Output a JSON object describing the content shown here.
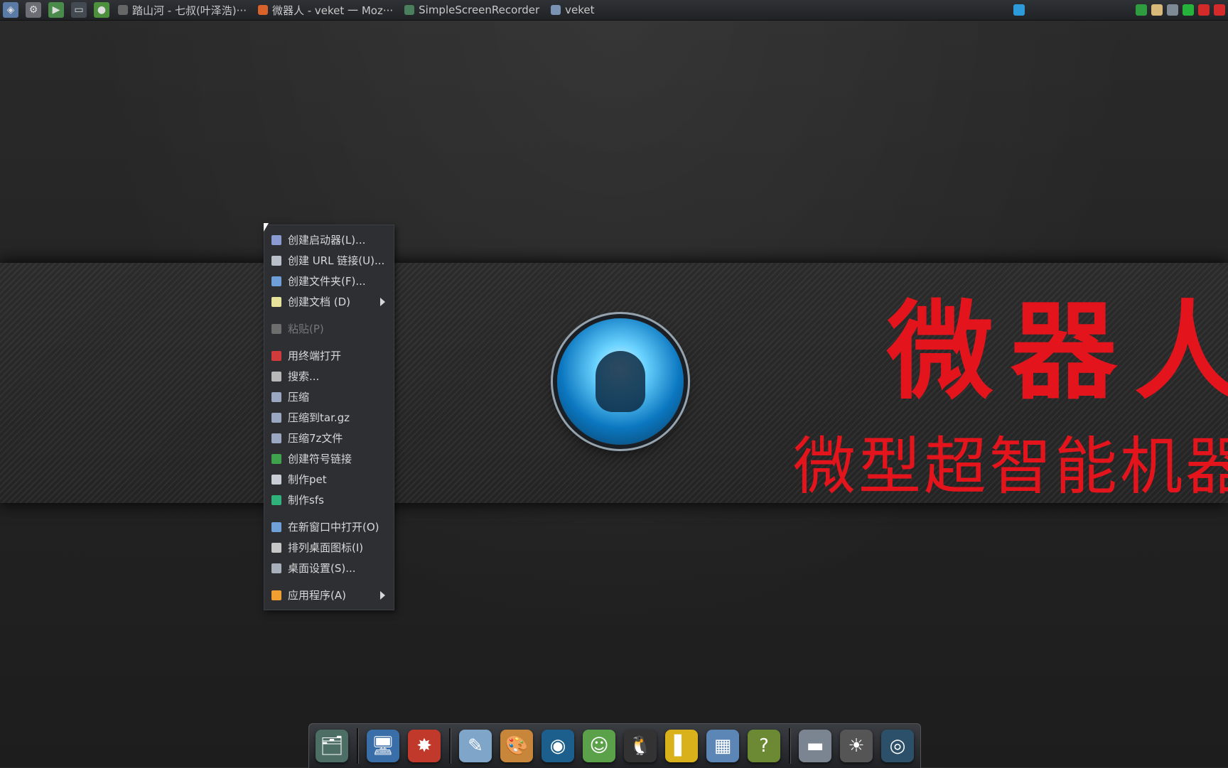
{
  "taskbar": {
    "launchers": [
      {
        "icon": "system-monitor-icon",
        "glyph": "◈",
        "color": "#5a7ba6"
      },
      {
        "icon": "settings-gear-icon",
        "glyph": "⚙",
        "color": "#6b6f75"
      },
      {
        "icon": "play-icon",
        "glyph": "▶",
        "color": "#4a8a4a"
      },
      {
        "icon": "terminal-icon",
        "glyph": "▭",
        "color": "#444a52"
      },
      {
        "icon": "globe-icon",
        "glyph": "●",
        "color": "#4c8f3c"
      }
    ],
    "tasks": [
      {
        "label": "踏山河 - 七叔(叶泽浩)···",
        "icon": "music-player-icon",
        "color": "#666"
      },
      {
        "label": "微器人 - veket 一 Moz···",
        "icon": "firefox-icon",
        "color": "#d9622b"
      },
      {
        "label": "SimpleScreenRecorder",
        "icon": "recorder-icon",
        "color": "#4a7f5d"
      },
      {
        "label": "veket",
        "icon": "folder-icon",
        "color": "#7a93b5"
      }
    ],
    "tray": [
      {
        "icon": "display-icon",
        "color": "#2d9bd9"
      },
      {
        "icon": "shield-icon",
        "color": "#2e9c3f"
      },
      {
        "icon": "clipboard-icon",
        "color": "#d8b97a"
      },
      {
        "icon": "network-icon",
        "color": "#7e8a95"
      },
      {
        "icon": "battery-icon",
        "color": "#25b33c"
      },
      {
        "icon": "record-icon",
        "color": "#d42a2a"
      },
      {
        "icon": "input-method-icon",
        "color": "#d42a2a"
      }
    ]
  },
  "wallpaper": {
    "title": "微器人",
    "subtitle": "微型超智能机器",
    "title_color": "#e3141c"
  },
  "menu": {
    "items": [
      {
        "label": "创建启动器(L)...",
        "icon": "launcher-create-icon",
        "color": "#8a9bd1",
        "submenu": false,
        "disabled": false
      },
      {
        "label": "创建 URL 链接(U)...",
        "icon": "link-icon",
        "color": "#b9c0c9",
        "submenu": false,
        "disabled": false
      },
      {
        "label": "创建文件夹(F)...",
        "icon": "folder-new-icon",
        "color": "#6e9fd8",
        "submenu": false,
        "disabled": false
      },
      {
        "label": "创建文档 (D)",
        "icon": "document-new-icon",
        "color": "#e8e39c",
        "submenu": true,
        "disabled": false
      },
      {
        "separator": true
      },
      {
        "label": "粘贴(P)",
        "icon": "paste-icon",
        "color": "#6d6d6d",
        "submenu": false,
        "disabled": true
      },
      {
        "separator": true
      },
      {
        "label": "用终端打开",
        "icon": "terminal-open-icon",
        "color": "#d23b3b",
        "submenu": false,
        "disabled": false
      },
      {
        "label": "搜索...",
        "icon": "search-icon",
        "color": "#b8b8b8",
        "submenu": false,
        "disabled": false
      },
      {
        "label": "压缩",
        "icon": "archive-icon",
        "color": "#9aa8c2",
        "submenu": false,
        "disabled": false
      },
      {
        "label": "压缩到tar.gz",
        "icon": "archive-targz-icon",
        "color": "#9aa8c2",
        "submenu": false,
        "disabled": false
      },
      {
        "label": "压缩7z文件",
        "icon": "archive-7z-icon",
        "color": "#9aa8c2",
        "submenu": false,
        "disabled": false
      },
      {
        "label": "创建符号链接",
        "icon": "symlink-icon",
        "color": "#3fa34d",
        "submenu": false,
        "disabled": false
      },
      {
        "label": "制作pet",
        "icon": "package-icon",
        "color": "#c9ced6",
        "submenu": false,
        "disabled": false
      },
      {
        "label": "制作sfs",
        "icon": "sfs-icon",
        "color": "#2fb37a",
        "submenu": false,
        "disabled": false
      },
      {
        "separator": true
      },
      {
        "label": "在新窗口中打开(O)",
        "icon": "window-new-icon",
        "color": "#6fa0d8",
        "submenu": false,
        "disabled": false
      },
      {
        "label": "排列桌面图标(I)",
        "icon": "sort-icon",
        "color": "#c7c7c7",
        "submenu": false,
        "disabled": false
      },
      {
        "label": "桌面设置(S)...",
        "icon": "desktop-settings-icon",
        "color": "#a7b0bb",
        "submenu": false,
        "disabled": false
      },
      {
        "separator": true
      },
      {
        "label": "应用程序(A)",
        "icon": "applications-icon",
        "color": "#f0a030",
        "submenu": true,
        "disabled": false
      }
    ]
  },
  "dock": {
    "groups": [
      [
        {
          "icon": "file-manager-icon",
          "glyph": "🗂",
          "color": "#4c6e64"
        }
      ],
      [
        {
          "icon": "desktop-computer-icon",
          "glyph": "🖥",
          "color": "#3a6ea8"
        },
        {
          "icon": "porcupine-icon",
          "glyph": "✸",
          "color": "#c0392b"
        }
      ],
      [
        {
          "icon": "text-editor-icon",
          "glyph": "✎",
          "color": "#7fa5c9"
        },
        {
          "icon": "paint-palette-icon",
          "glyph": "🎨",
          "color": "#c8863a"
        },
        {
          "icon": "media-player-icon",
          "glyph": "◉",
          "color": "#1c5f8c"
        },
        {
          "icon": "chat-users-icon",
          "glyph": "☺",
          "color": "#5aa14a"
        },
        {
          "icon": "penguin-icon",
          "glyph": "🐧",
          "color": "#333"
        },
        {
          "icon": "notebook-icon",
          "glyph": "▌",
          "color": "#d9b21b"
        },
        {
          "icon": "chart-app-icon",
          "glyph": "▦",
          "color": "#5b86b5"
        },
        {
          "icon": "help-icon",
          "glyph": "?",
          "color": "#6b8a33"
        }
      ],
      [
        {
          "icon": "storage-drive-icon",
          "glyph": "▬",
          "color": "#7a8591"
        },
        {
          "icon": "brightness-icon",
          "glyph": "☀",
          "color": "#555"
        },
        {
          "icon": "web-browser-icon",
          "glyph": "◎",
          "color": "#2c4f6a"
        }
      ]
    ]
  }
}
